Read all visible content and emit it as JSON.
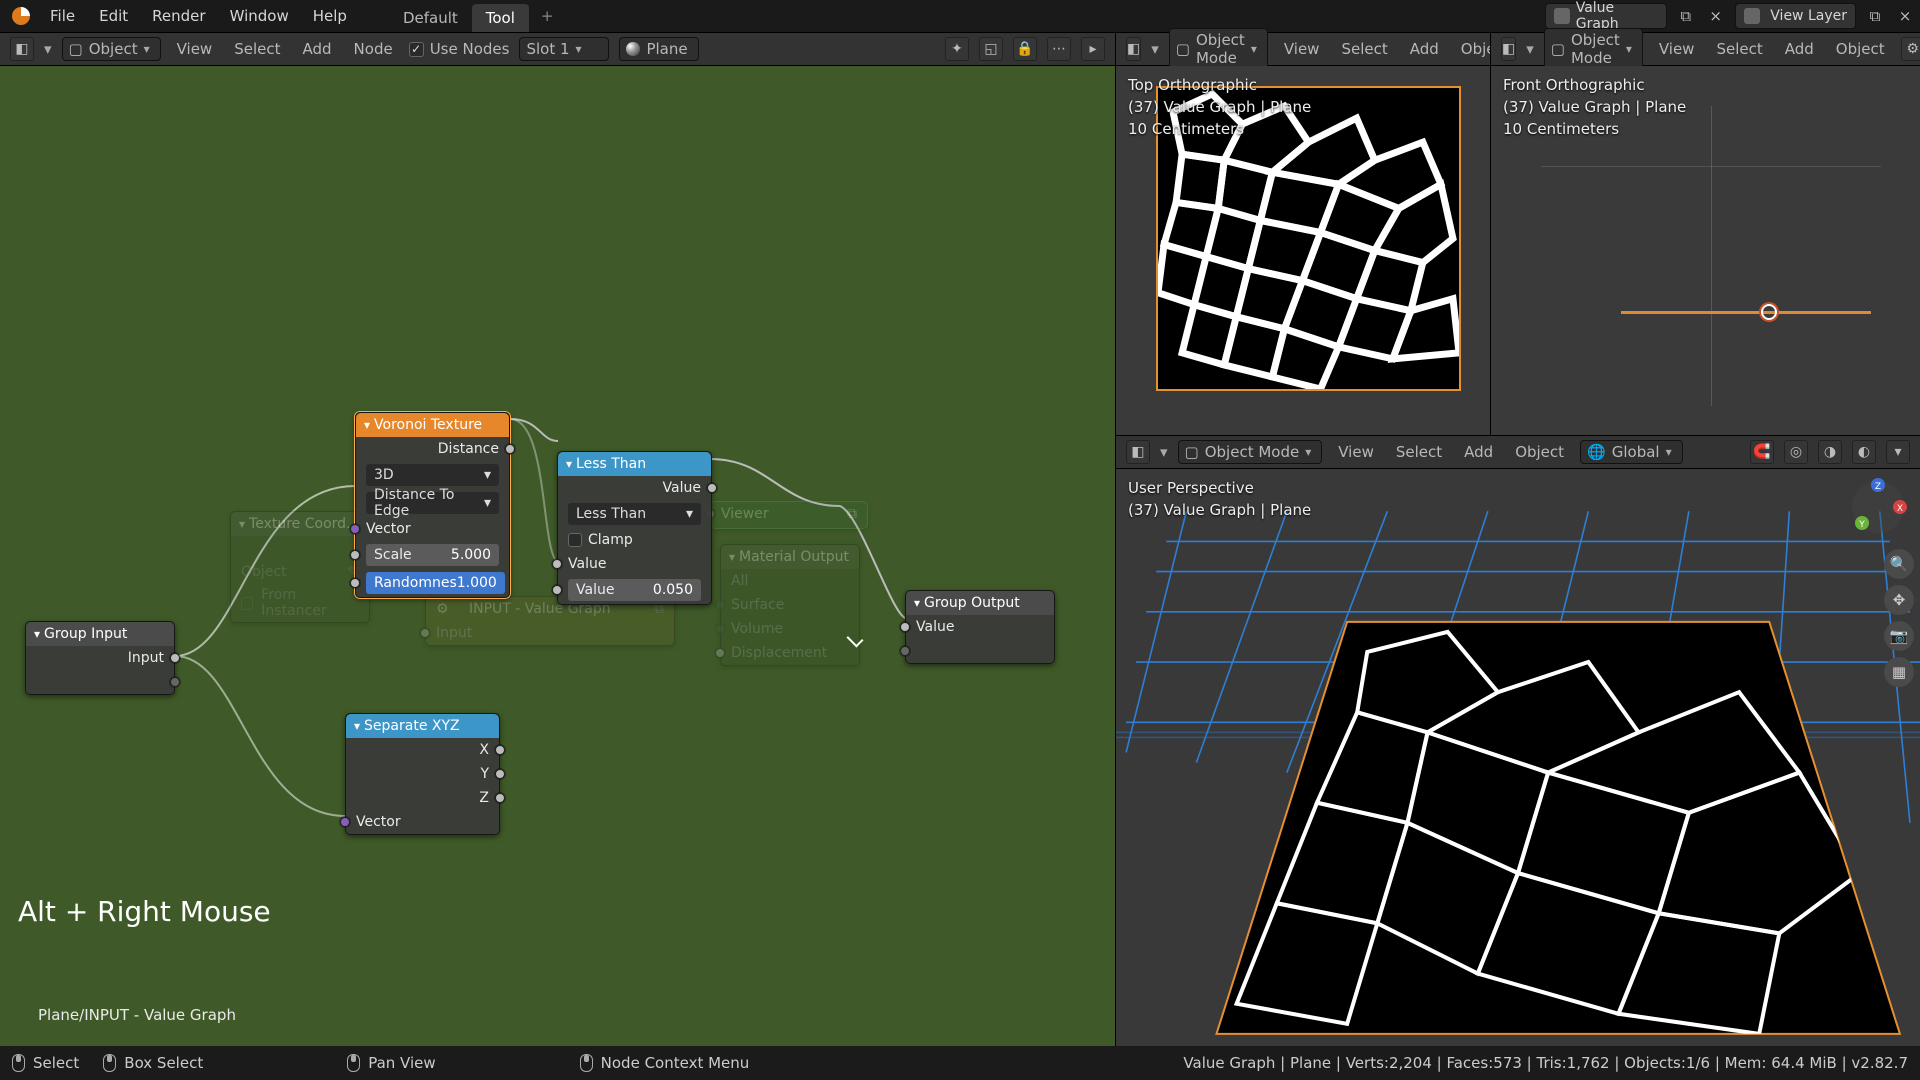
{
  "topbar": {
    "menus": [
      "File",
      "Edit",
      "Render",
      "Window",
      "Help"
    ],
    "tabs": [
      {
        "label": "Default",
        "active": false
      },
      {
        "label": "Tool",
        "active": true
      }
    ],
    "scene_label": "Value Graph",
    "viewlayer_label": "View Layer"
  },
  "nodeEditor": {
    "menus": [
      "View",
      "Select",
      "Add",
      "Node"
    ],
    "object_mode": "Object",
    "use_nodes_label": "Use Nodes",
    "use_nodes_checked": true,
    "slot": "Slot 1",
    "material": "Plane",
    "hint": "Alt + Right Mouse",
    "path": "Plane/INPUT - Value Graph"
  },
  "nodes": {
    "groupInput": {
      "title": "Group Input",
      "out": "Input"
    },
    "voronoi": {
      "title": "Voronoi Texture",
      "out": "Distance",
      "dim": "3D",
      "feature": "Distance To Edge",
      "vector": "Vector",
      "scale_label": "Scale",
      "scale_value": "5.000",
      "rand_label": "Randomnes",
      "rand_value": "1.000"
    },
    "lessThan": {
      "title": "Less Than",
      "out": "Value",
      "op": "Less Than",
      "clamp": "Clamp",
      "in_label": "Value",
      "value_label": "Value",
      "value_value": "0.050"
    },
    "separate": {
      "title": "Separate XYZ",
      "x": "X",
      "y": "Y",
      "z": "Z",
      "vector": "Vector"
    },
    "groupOutput": {
      "title": "Group Output",
      "in": "Value"
    },
    "texCoord": {
      "title": "Texture Coord…",
      "obj": "Object",
      "inst": "From Instancer"
    },
    "valueGraph": {
      "title": "INPUT - Value Graph",
      "in": "Input"
    },
    "viewer": {
      "title": "Viewer"
    },
    "matOut": {
      "title": "Material Output",
      "target": "All",
      "surface": "Surface",
      "volume": "Volume",
      "disp": "Displacement"
    }
  },
  "viewports": {
    "top": {
      "title": "Top Orthographic",
      "line2": "(37)  Value Graph | Plane",
      "line3": "10 Centimeters",
      "mode_label": "Object Mode",
      "menus": [
        "View",
        "Select",
        "Add",
        "Object"
      ]
    },
    "front": {
      "title": "Front Orthographic",
      "line2": "(37)  Value Graph | Plane",
      "line3": "10 Centimeters",
      "mode_label": "Object Mode",
      "menus": [
        "View",
        "Select",
        "Add",
        "Object"
      ]
    },
    "user": {
      "title": "User Perspective",
      "line2": "(37)  Value Graph | Plane",
      "mode_label": "Object Mode",
      "orient": "Global",
      "menus": [
        "View",
        "Select",
        "Add",
        "Object"
      ]
    }
  },
  "statusbar": {
    "select": "Select",
    "box": "Box Select",
    "pan": "Pan View",
    "context": "Node Context Menu",
    "stats": "Value Graph | Plane | Verts:2,204 | Faces:573 | Tris:1,762 | Objects:1/6 | Mem: 64.4 MiB | v2.82.7"
  }
}
